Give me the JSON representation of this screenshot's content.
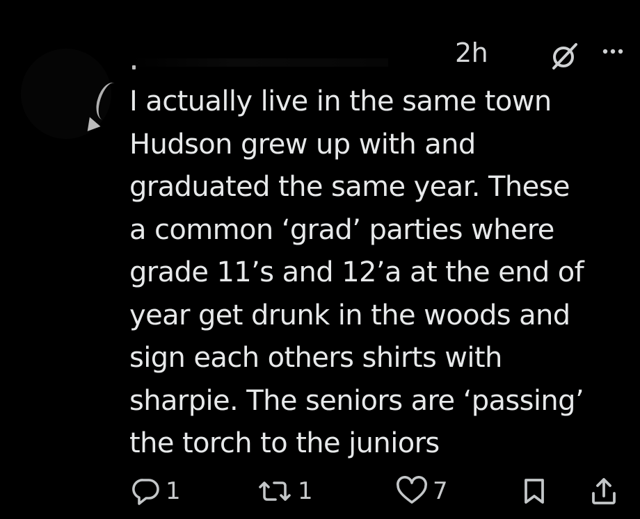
{
  "tweet": {
    "timestamp": "2h",
    "text": "I actually live in the same town\nHudson grew up with and\ngraduated the same year. These\na common ‘grad’ parties where\ngrade 11’s and 12’a at the end of\nyear get drunk in the woods and\nsign each others shirts with\nsharpie. The seniors are ‘passing’\nthe torch to the juniors",
    "header_icons": {
      "grok": "grok-icon",
      "more": "more-icon"
    },
    "actions": {
      "reply": {
        "icon": "reply-icon",
        "count": "1"
      },
      "repost": {
        "icon": "repost-icon",
        "count": "1"
      },
      "like": {
        "icon": "heart-icon",
        "count": "7"
      },
      "bookmark": {
        "icon": "bookmark-icon"
      },
      "share": {
        "icon": "share-icon"
      }
    },
    "colors": {
      "background": "#000000",
      "text": "#e7e9ea",
      "icon": "#b9bcbe"
    }
  }
}
